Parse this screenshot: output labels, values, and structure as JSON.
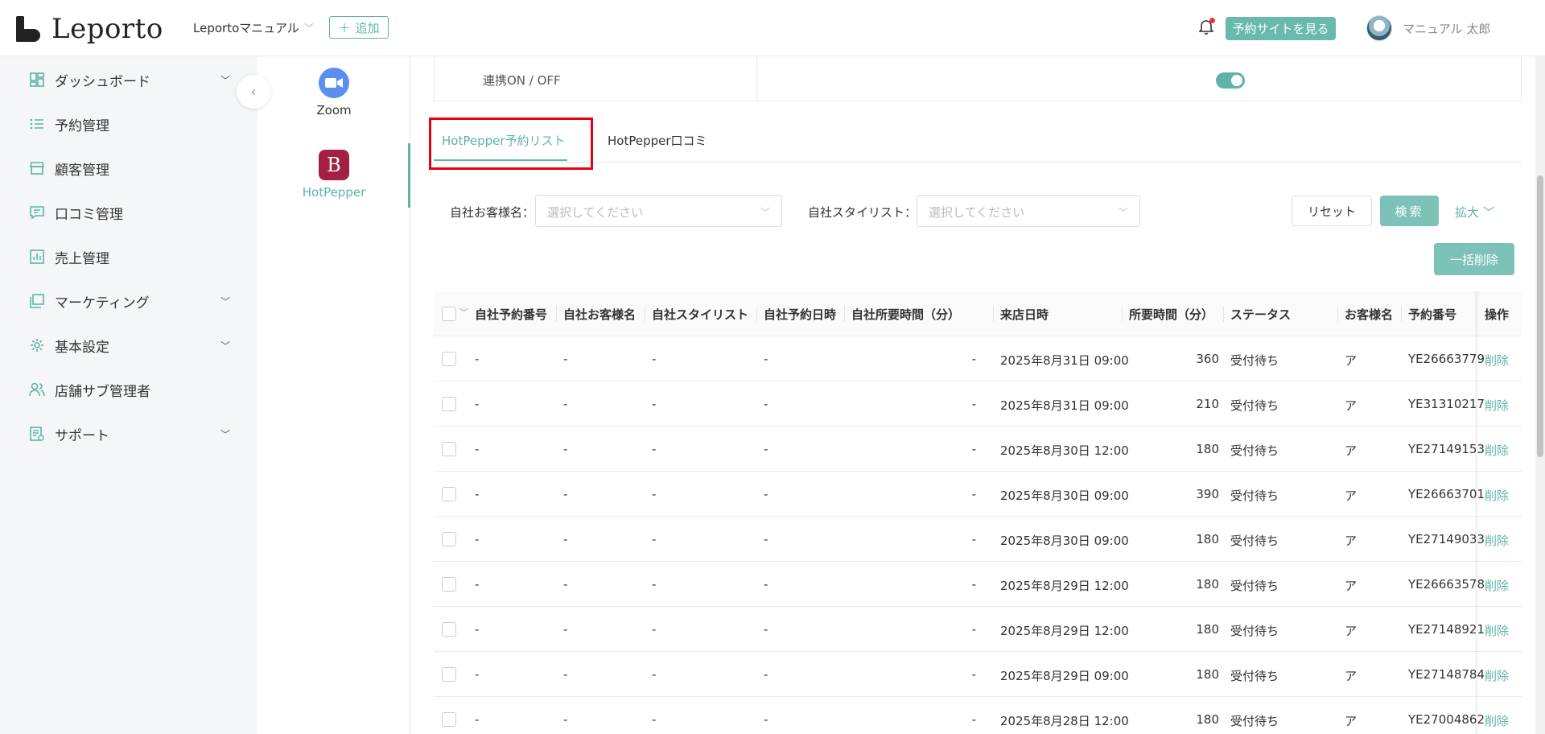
{
  "header": {
    "logo_text": "Leporto",
    "store_name": "Leportoマニュアル",
    "add_label": "追加",
    "view_site_label": "予約サイトを見る",
    "user_name": "マニュアル 太郎",
    "notification_dot_color": "#e33333"
  },
  "sidebar": {
    "items": [
      {
        "label": "ダッシュボード",
        "icon": "dashboard-icon",
        "has_children": true
      },
      {
        "label": "予約管理",
        "icon": "list-icon",
        "has_children": false
      },
      {
        "label": "顧客管理",
        "icon": "store-icon",
        "has_children": false
      },
      {
        "label": "口コミ管理",
        "icon": "comment-icon",
        "has_children": false
      },
      {
        "label": "売上管理",
        "icon": "chart-icon",
        "has_children": false
      },
      {
        "label": "マーケティング",
        "icon": "window-icon",
        "has_children": true
      },
      {
        "label": "基本設定",
        "icon": "gear-icon",
        "has_children": true
      },
      {
        "label": "店舗サブ管理者",
        "icon": "users-icon",
        "has_children": false
      },
      {
        "label": "サポート",
        "icon": "support-icon",
        "has_children": true
      }
    ]
  },
  "integrations": {
    "items": [
      {
        "label": "Zoom",
        "active": false
      },
      {
        "label": "HotPepper",
        "active": true
      }
    ]
  },
  "settings": {
    "toggle_label": "連携ON / OFF",
    "toggle_on": true
  },
  "tabs": [
    {
      "label": "HotPepper予約リスト",
      "active": true
    },
    {
      "label": "HotPepper口コミ",
      "active": false
    }
  ],
  "filters": {
    "customer_label": "自社お客様名：",
    "customer_placeholder": "選択してください",
    "stylist_label": "自社スタイリスト：",
    "stylist_placeholder": "選択してください",
    "reset_label": "リセット",
    "search_label": "検索",
    "expand_label": "拡大",
    "bulk_delete_label": "一括削除"
  },
  "table": {
    "columns": [
      "自社予約番号",
      "自社お客様名",
      "自社スタイリスト",
      "自社予約日時",
      "自社所要時間（分）",
      "来店日時",
      "所要時間（分）",
      "ステータス",
      "お客様名",
      "予約番号",
      "操作"
    ],
    "action_label": "削除",
    "rows": [
      {
        "c1": "-",
        "c2": "-",
        "c3": "-",
        "c4": "-",
        "c5": "-",
        "visit": "2025年8月31日 09:00",
        "minutes": "360",
        "status": "受付待ち",
        "customer": "ア",
        "number": "YE26663779"
      },
      {
        "c1": "-",
        "c2": "-",
        "c3": "-",
        "c4": "-",
        "c5": "-",
        "visit": "2025年8月31日 09:00",
        "minutes": "210",
        "status": "受付待ち",
        "customer": "ア",
        "number": "YE31310217"
      },
      {
        "c1": "-",
        "c2": "-",
        "c3": "-",
        "c4": "-",
        "c5": "-",
        "visit": "2025年8月30日 12:00",
        "minutes": "180",
        "status": "受付待ち",
        "customer": "ア",
        "number": "YE27149153"
      },
      {
        "c1": "-",
        "c2": "-",
        "c3": "-",
        "c4": "-",
        "c5": "-",
        "visit": "2025年8月30日 09:00",
        "minutes": "390",
        "status": "受付待ち",
        "customer": "ア",
        "number": "YE26663701"
      },
      {
        "c1": "-",
        "c2": "-",
        "c3": "-",
        "c4": "-",
        "c5": "-",
        "visit": "2025年8月30日 09:00",
        "minutes": "180",
        "status": "受付待ち",
        "customer": "ア",
        "number": "YE27149033"
      },
      {
        "c1": "-",
        "c2": "-",
        "c3": "-",
        "c4": "-",
        "c5": "-",
        "visit": "2025年8月29日 12:00",
        "minutes": "180",
        "status": "受付待ち",
        "customer": "ア",
        "number": "YE26663578"
      },
      {
        "c1": "-",
        "c2": "-",
        "c3": "-",
        "c4": "-",
        "c5": "-",
        "visit": "2025年8月29日 12:00",
        "minutes": "180",
        "status": "受付待ち",
        "customer": "ア",
        "number": "YE27148921"
      },
      {
        "c1": "-",
        "c2": "-",
        "c3": "-",
        "c4": "-",
        "c5": "-",
        "visit": "2025年8月29日 09:00",
        "minutes": "180",
        "status": "受付待ち",
        "customer": "ア",
        "number": "YE27148784"
      },
      {
        "c1": "-",
        "c2": "-",
        "c3": "-",
        "c4": "-",
        "c5": "-",
        "visit": "2025年8月28日 12:00",
        "minutes": "180",
        "status": "受付待ち",
        "customer": "ア",
        "number": "YE27004862"
      }
    ]
  },
  "colors": {
    "accent": "#5fb3a8",
    "accent_button": "#7dc2b7",
    "highlight_border": "#e60012",
    "hotpepper_brand": "#a51f44",
    "zoom_brand": "#5b8ef0"
  }
}
